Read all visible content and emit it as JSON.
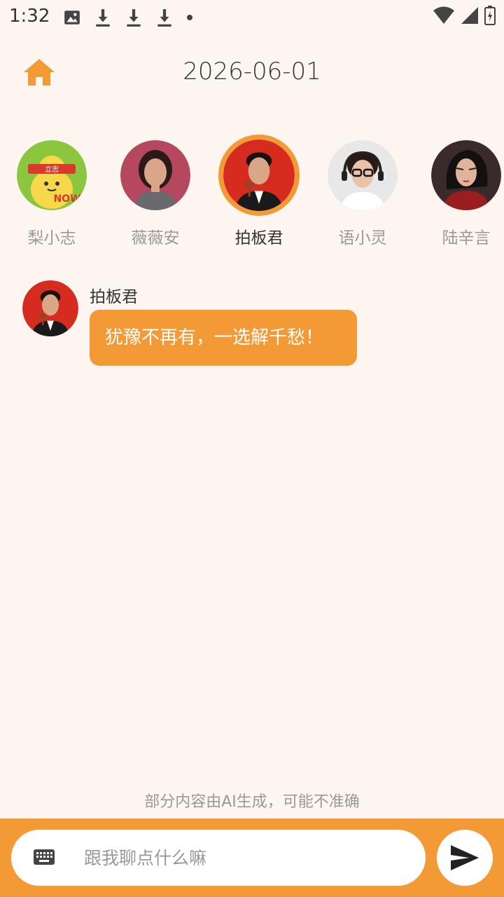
{
  "status_bar": {
    "time": "1:32"
  },
  "header": {
    "date": "2026-06-01"
  },
  "characters": [
    {
      "name": "梨小志",
      "selected": false,
      "badge": "立志",
      "badge_sub": "NOW"
    },
    {
      "name": "薇薇安",
      "selected": false
    },
    {
      "name": "拍板君",
      "selected": true
    },
    {
      "name": "语小灵",
      "selected": false
    },
    {
      "name": "陆辛言",
      "selected": false
    }
  ],
  "conversation": {
    "sender": "拍板君",
    "message": "犹豫不再有，一选解千愁！"
  },
  "disclaimer": "部分内容由AI生成，可能不准确",
  "input": {
    "placeholder": "跟我聊点什么嘛",
    "value": ""
  },
  "colors": {
    "accent": "#f39a36",
    "background": "#fdf6f0"
  }
}
